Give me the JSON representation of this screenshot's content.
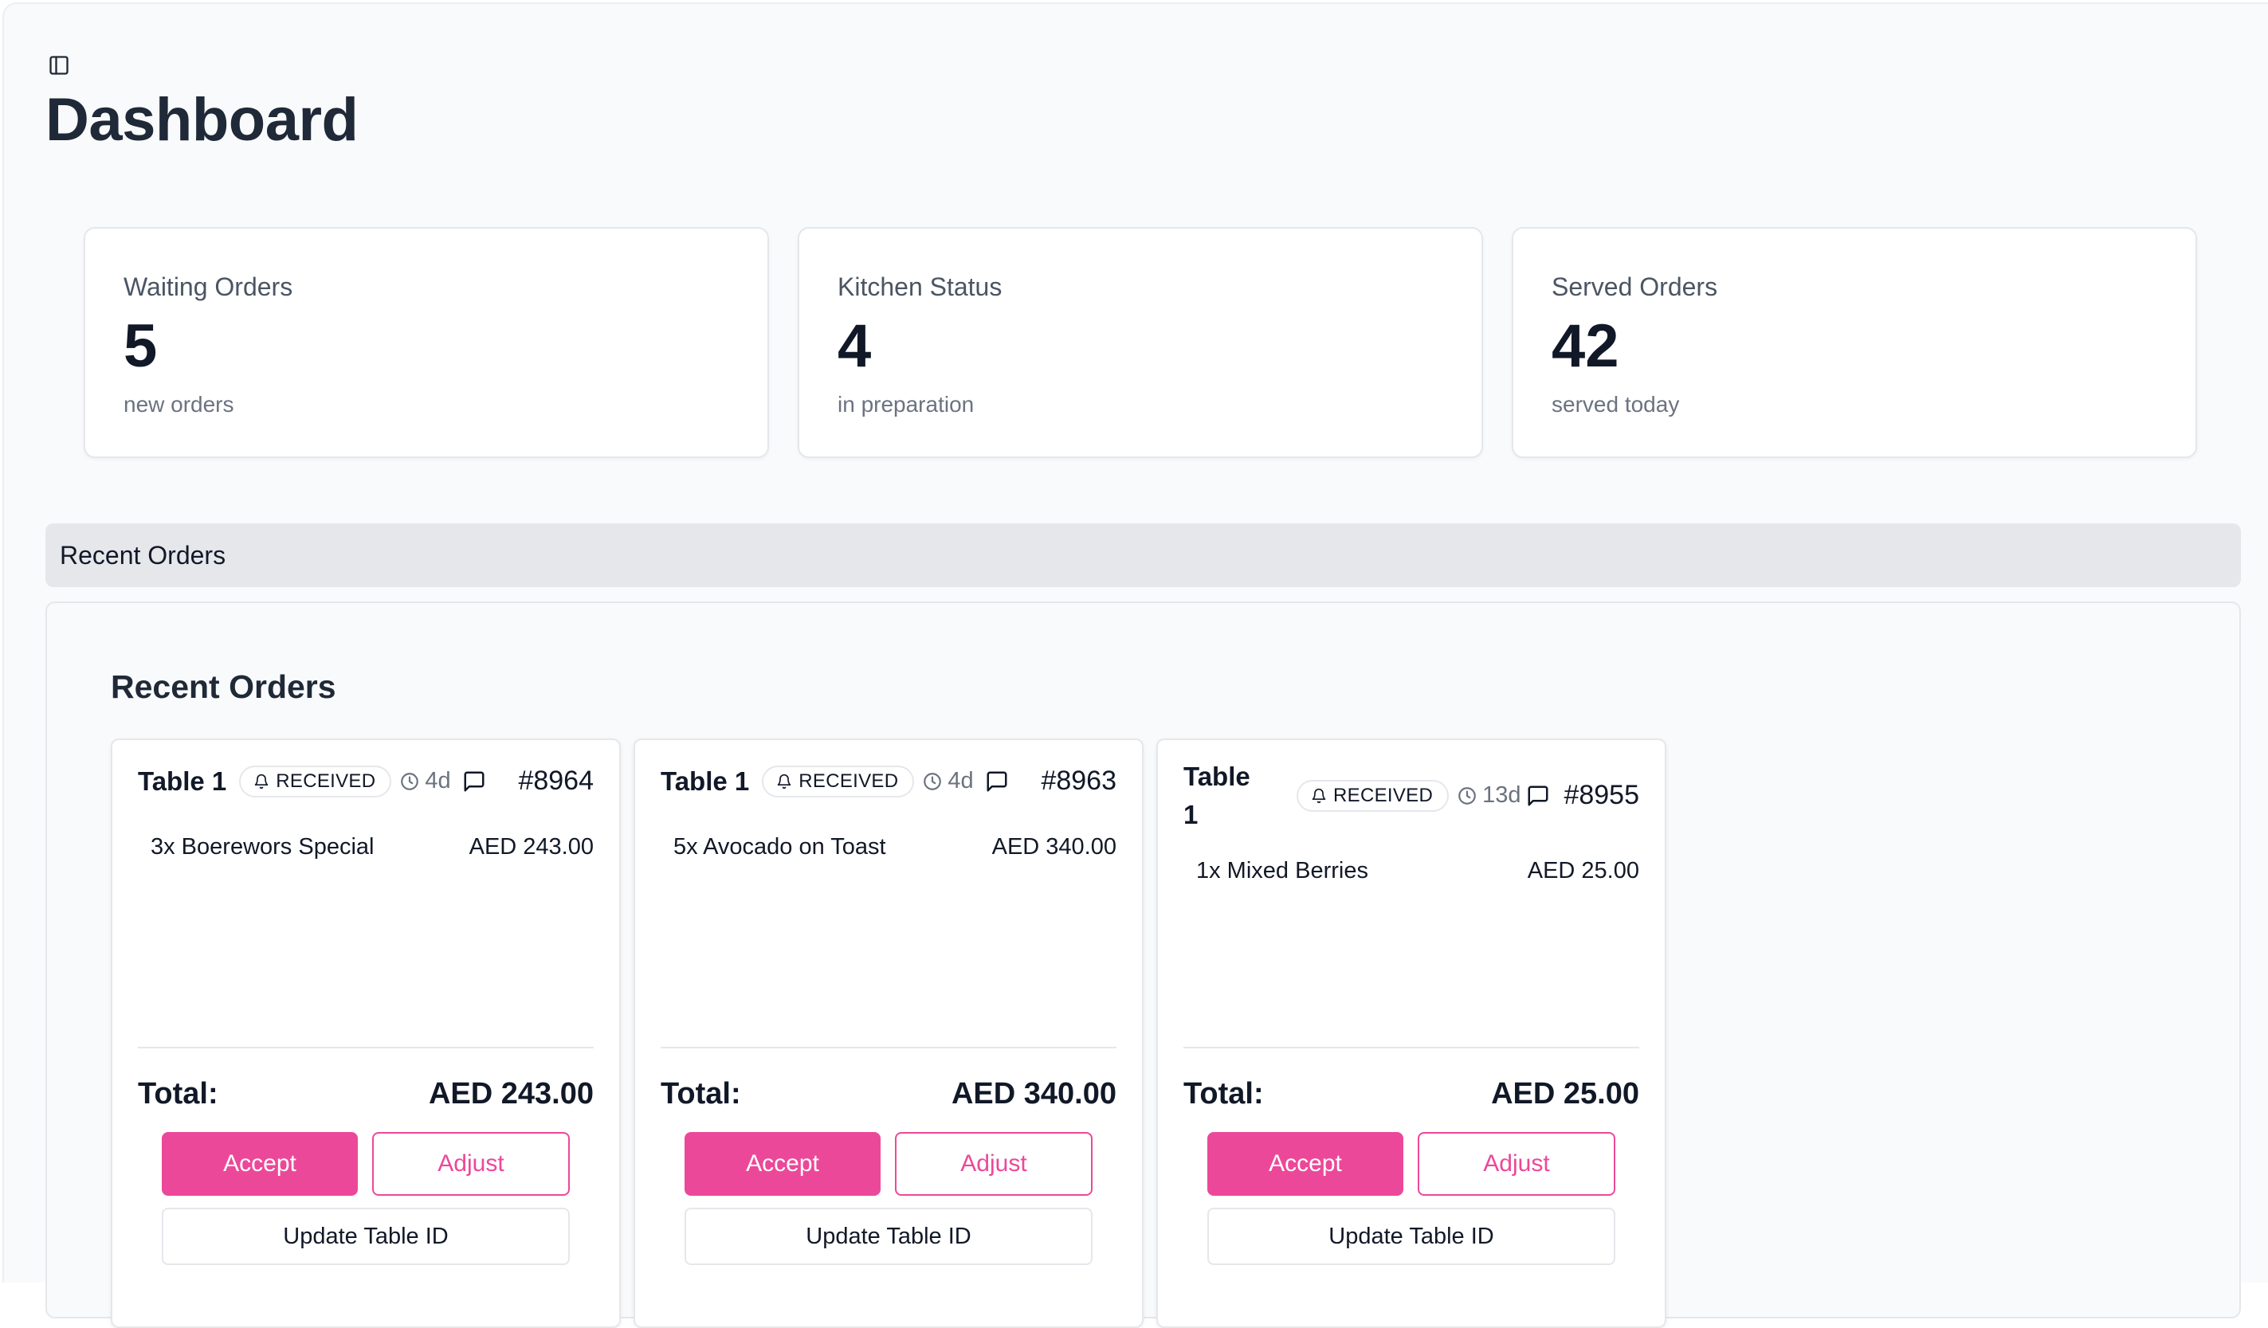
{
  "header": {
    "title": "Dashboard"
  },
  "stats": [
    {
      "label": "Waiting Orders",
      "value": "5",
      "sub": "new orders"
    },
    {
      "label": "Kitchen Status",
      "value": "4",
      "sub": "in preparation"
    },
    {
      "label": "Served Orders",
      "value": "42",
      "sub": "served today"
    }
  ],
  "section": {
    "label": "Recent Orders"
  },
  "panel": {
    "title": "Recent Orders"
  },
  "orders": [
    {
      "table": "Table 1",
      "status": "RECEIVED",
      "age": "4d",
      "number": "#8964",
      "item": {
        "name": "3x Boerewors Special",
        "price": "AED 243.00"
      },
      "total_label": "Total:",
      "total": "AED 243.00",
      "accept_label": "Accept",
      "adjust_label": "Adjust",
      "update_label": "Update Table ID"
    },
    {
      "table": "Table 1",
      "status": "RECEIVED",
      "age": "4d",
      "number": "#8963",
      "item": {
        "name": "5x Avocado on Toast",
        "price": "AED 340.00"
      },
      "total_label": "Total:",
      "total": "AED 340.00",
      "accept_label": "Accept",
      "adjust_label": "Adjust",
      "update_label": "Update Table ID"
    },
    {
      "table": "Table 1",
      "status": "RECEIVED",
      "age": "13d",
      "number": "#8955",
      "item": {
        "name": "1x Mixed Berries",
        "price": "AED 25.00"
      },
      "total_label": "Total:",
      "total": "AED 25.00",
      "accept_label": "Accept",
      "adjust_label": "Adjust",
      "update_label": "Update Table ID"
    }
  ],
  "colors": {
    "accent": "#ec4899",
    "background": "#f9fafb",
    "border": "#e5e7eb",
    "section_bar": "#e5e7eb"
  },
  "icons": {
    "sidebar_toggle": "panel-left-icon",
    "status": "bell-icon",
    "age": "clock-icon",
    "note": "message-square-icon"
  }
}
